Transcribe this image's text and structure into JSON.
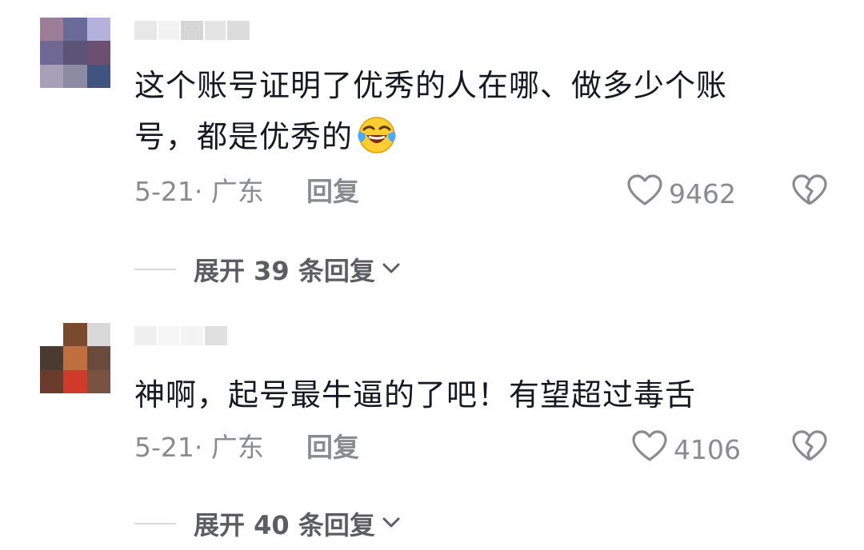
{
  "comments": [
    {
      "text_line1": "这个账号证明了优秀的人在哪、做多少个账",
      "text_line2": "号，都是优秀的",
      "emoji_icon": "face-with-tears-of-joy-icon",
      "date": "5-21",
      "location": "· 广东",
      "reply_label": "回复",
      "likes": "9462",
      "expand_label": "展开 39 条回复"
    },
    {
      "text_line1": "神啊，起号最牛逼的了吧！有望超过毒舌",
      "date": "5-21",
      "location": "· 广东",
      "reply_label": "回复",
      "likes": "4106",
      "expand_label": "展开 40 条回复"
    }
  ],
  "colors": {
    "text": "#161823",
    "meta": "#8a8b91",
    "expand": "#5c5d63"
  }
}
